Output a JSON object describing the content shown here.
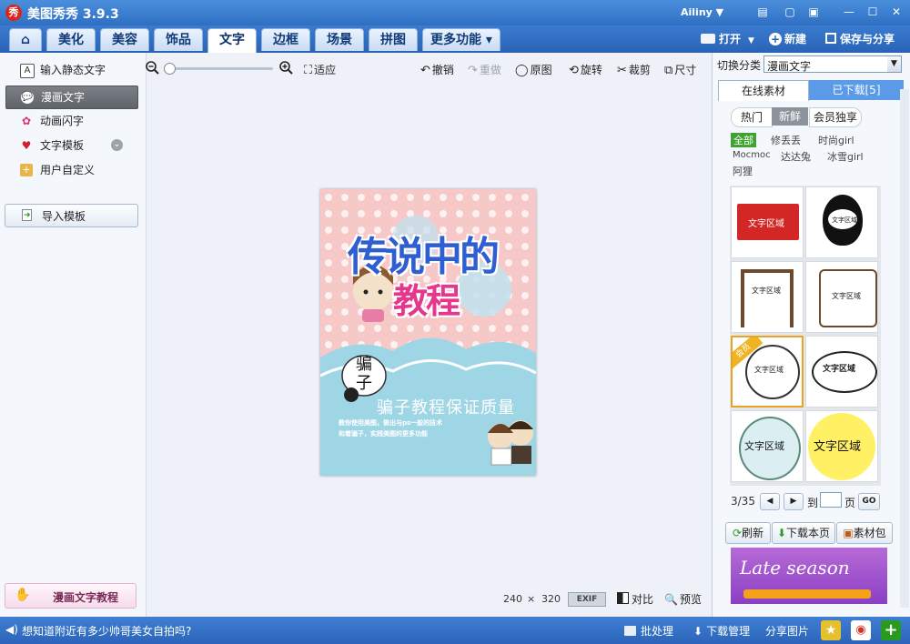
{
  "app": {
    "logo_glyph": "秀",
    "title": "美图秀秀 3.9.3",
    "user": "Ailiny ▼"
  },
  "window_controls": {
    "skin": "▤",
    "message": "▢",
    "restore": "▣",
    "minimize": "—",
    "maximize": "☐",
    "close": "✕"
  },
  "nav": {
    "home_glyph": "⌂",
    "tabs": [
      "美化",
      "美容",
      "饰品",
      "文字",
      "边框",
      "场景",
      "拼图"
    ],
    "more": "更多功能 ▾",
    "open": "打开",
    "new": "新建",
    "save": "保存与分享"
  },
  "left": {
    "items": [
      {
        "label": "输入静态文字",
        "icon": "A"
      },
      {
        "label": "漫画文字",
        "icon": "💬"
      },
      {
        "label": "动画闪字",
        "icon": "✿"
      },
      {
        "label": "文字模板",
        "icon": "♥"
      },
      {
        "label": "用户自定义",
        "icon": "+"
      }
    ],
    "expand_glyph": "⌄",
    "import": "导入模板",
    "tutorial": "漫画文字教程"
  },
  "toolbar": {
    "fit": "适应",
    "undo": "撤销",
    "redo": "重做",
    "original": "原图",
    "rotate": "旋转",
    "crop": "裁剪",
    "size": "尺寸"
  },
  "canvas": {
    "title_line1": "传说中的",
    "title_line2": "教程",
    "bubble": "骗子",
    "headline": "骗子教程保证质量",
    "sub1": "教你使用美图，做出与ps一般的技术",
    "sub2": "和着骗子，实践美图的更多功能"
  },
  "footer": {
    "width": "240",
    "x": "×",
    "height": "320",
    "exif": "EXIF",
    "compare": "对比",
    "preview": "预览"
  },
  "right": {
    "switch_label": "切换分类",
    "category": "漫画文字",
    "tabs": [
      "在线素材",
      "已下载[5]"
    ],
    "filters": [
      "热门",
      "新鲜",
      "会员独享"
    ],
    "authors": [
      "全部",
      "修丢丢",
      "时尚girl",
      "Mocmoc",
      "达达兔",
      "冰雪girl",
      "阿狸"
    ],
    "cells": [
      "文字区域",
      "文字区域",
      "文字区域",
      "文字区域",
      "文字区域",
      "文字区域",
      "文字区域",
      "文字区域"
    ],
    "vip_ribbon": "会员",
    "pager": {
      "current": "3/35",
      "prev": "◀",
      "next": "▶",
      "to": "到",
      "page": "页",
      "go": "GO"
    },
    "actions": {
      "refresh": "刷新",
      "download_page": "下载本页",
      "pack": "素材包"
    },
    "banner": "Late season"
  },
  "status": {
    "message": "想知道附近有多少帅哥美女自拍吗?",
    "batch": "批处理",
    "download": "下载管理",
    "share": "分享图片"
  },
  "colors": {
    "accent": "#2f6fc3",
    "active_tab": "#ffffff",
    "green": "#2a9a1e"
  }
}
